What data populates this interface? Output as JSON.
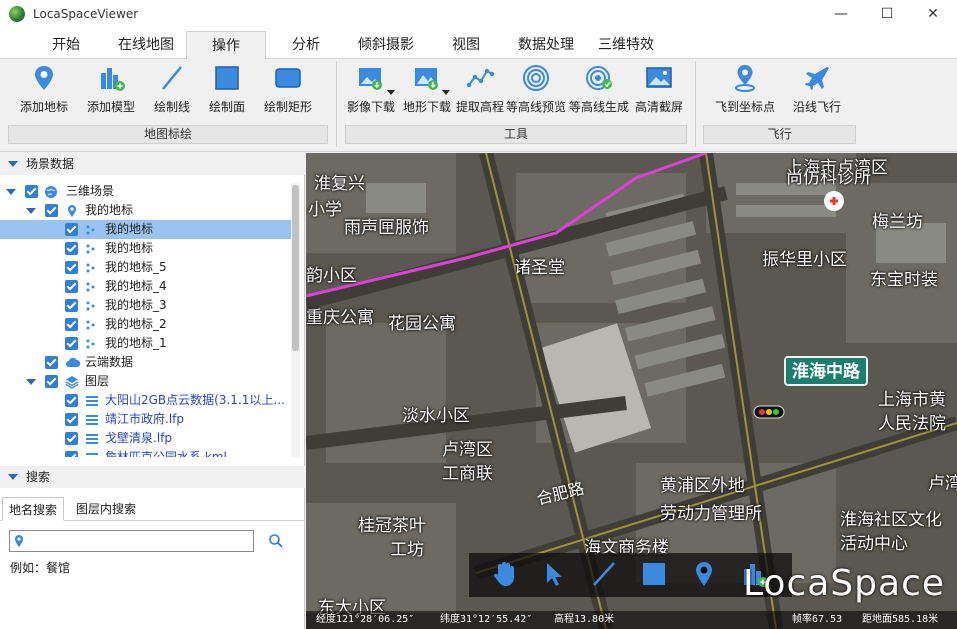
{
  "window": {
    "title": "LocaSpaceViewer",
    "minimize": "—",
    "maximize": "☐",
    "close": "✕"
  },
  "menu": {
    "tabs": [
      "开始",
      "在线地图",
      "操作",
      "分析",
      "倾斜摄影",
      "视图",
      "数据处理",
      "三维特效"
    ],
    "active": "操作"
  },
  "ribbon": {
    "groups": [
      {
        "label": "地图标绘",
        "buttons": [
          "添加地标",
          "添加模型",
          "绘制线",
          "绘制面",
          "绘制矩形"
        ]
      },
      {
        "label": "工具",
        "buttons": [
          "影像下载",
          "地形下载",
          "提取高程",
          "等高线预览",
          "等高线生成",
          "高清截屏"
        ]
      },
      {
        "label": "飞行",
        "buttons": [
          "飞到坐标点",
          "沿线飞行"
        ]
      }
    ]
  },
  "scene_panel": {
    "title": "场景数据",
    "tree": {
      "root": "三维场景",
      "my_places": "我的地标",
      "places": [
        "我的地标",
        "我的地标",
        "我的地标_5",
        "我的地标_4",
        "我的地标_3",
        "我的地标_2",
        "我的地标_1"
      ],
      "cloud": "云端数据",
      "layers": "图层",
      "layer_items": [
        "大阳山2GB点云数据(3.1.1以上...",
        "靖江市政府.lfp",
        "戈壁清泉.lfp",
        "詹林匹克公园水系.kml"
      ]
    }
  },
  "search_panel": {
    "title": "搜索",
    "tabs": [
      "地名搜索",
      "图层内搜索"
    ],
    "input_value": "",
    "hint": "例如：餐馆"
  },
  "map": {
    "labels": [
      "淮复兴",
      "小学",
      "雨声匣服饰",
      "诸圣堂",
      "韵小区",
      "重庆公寓",
      "花园公寓",
      "淡水小区",
      "卢湾区",
      "工商联",
      "桂冠茶叶",
      "工坊",
      "海文商务楼",
      "东大小区",
      "上海市卢湾区",
      "尚仿科诊所",
      "梅兰坊",
      "振华里小区",
      "东宝时装",
      "上海市黄",
      "人民法院",
      "黄浦区外地",
      "劳动力管理所",
      "淮海社区文化",
      "活动中心",
      "卢湾"
    ],
    "road_sign": "淮海中路",
    "road_name": "合肥路",
    "brand": "LocaSpace",
    "status": {
      "lon": "经度121°28′06.25″",
      "lat": "纬度31°12′55.42″",
      "elev": "高程13.80米",
      "fps": "帧率67.53",
      "dist": "距地面585.18米"
    }
  },
  "colors": {
    "accent": "#2f7fd6",
    "selection": "#99c3f0",
    "road_sign": "#1c7f6e",
    "metro_line": "#e040d8"
  }
}
